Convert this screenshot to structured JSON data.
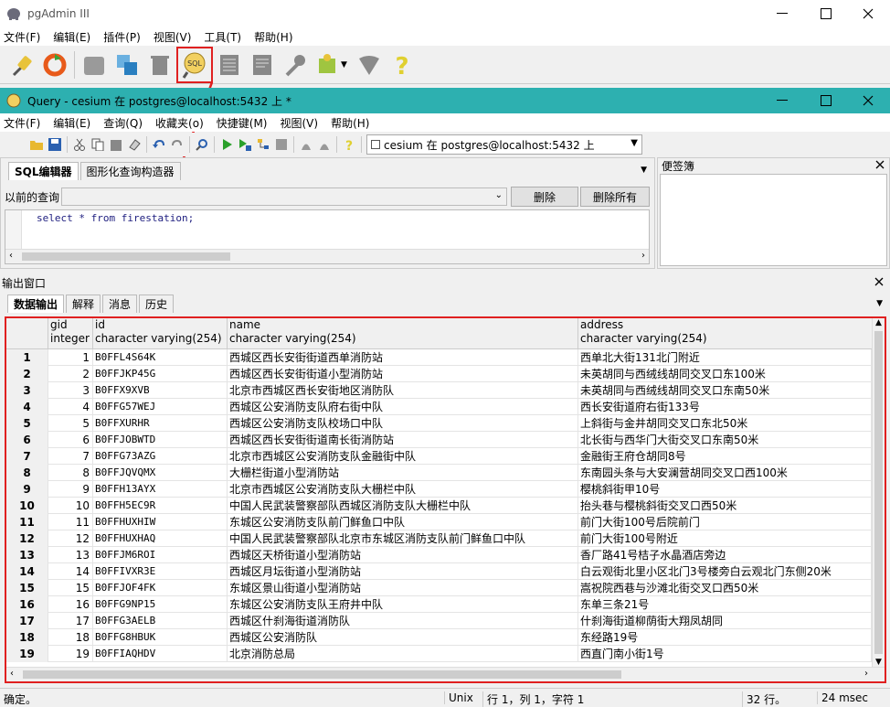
{
  "main_window": {
    "title": "pgAdmin III",
    "menu": [
      "文件(F)",
      "编辑(E)",
      "插件(P)",
      "视图(V)",
      "工具(T)",
      "帮助(H)"
    ]
  },
  "query_window": {
    "title": "Query - cesium 在  postgres@localhost:5432 上 *",
    "menu": [
      "文件(F)",
      "编辑(E)",
      "查询(Q)",
      "收藏夹(o)",
      "快捷键(M)",
      "视图(V)",
      "帮助(H)"
    ],
    "connection": "cesium 在  postgres@localhost:5432 上"
  },
  "editor": {
    "tabs": [
      "SQL编辑器",
      "图形化查询构造器"
    ],
    "prev_query_label": "以前的查询",
    "delete_label": "删除",
    "delete_all_label": "删除所有",
    "sql": "select * from firestation;"
  },
  "notepad": {
    "title": "便签簿"
  },
  "output": {
    "title": "输出窗口",
    "tabs": [
      "数据输出",
      "解释",
      "消息",
      "历史"
    ],
    "columns": [
      {
        "name": "gid",
        "type": "integer"
      },
      {
        "name": "id",
        "type": "character varying(254)"
      },
      {
        "name": "name",
        "type": "character varying(254)"
      },
      {
        "name": "address",
        "type": "character varying(254)"
      }
    ],
    "rows": [
      {
        "n": "1",
        "gid": "1",
        "id": "B0FFL4S64K",
        "name": "西城区西长安街街道西单消防站",
        "address": "西单北大街131北门附近"
      },
      {
        "n": "2",
        "gid": "2",
        "id": "B0FFJKP45G",
        "name": "西城区西长安街街道小型消防站",
        "address": "未英胡同与西绒线胡同交叉口东100米"
      },
      {
        "n": "3",
        "gid": "3",
        "id": "B0FFX9XVB",
        "name": "北京市西城区西长安街地区消防队",
        "address": "未英胡同与西绒线胡同交叉口东南50米"
      },
      {
        "n": "4",
        "gid": "4",
        "id": "B0FFG57WEJ",
        "name": "西城区公安消防支队府右街中队",
        "address": "西长安街道府右街133号"
      },
      {
        "n": "5",
        "gid": "5",
        "id": "B0FFXURHR",
        "name": "西城区公安消防支队校场口中队",
        "address": "上斜街与金井胡同交叉口东北50米"
      },
      {
        "n": "6",
        "gid": "6",
        "id": "B0FFJOBWTD",
        "name": "西城区西长安街街道南长街消防站",
        "address": "北长街与西华门大街交叉口东南50米"
      },
      {
        "n": "7",
        "gid": "7",
        "id": "B0FFG73AZG",
        "name": "北京市西城区公安消防支队金融街中队",
        "address": "金融街王府仓胡同8号"
      },
      {
        "n": "8",
        "gid": "8",
        "id": "B0FFJQVQMX",
        "name": "大栅栏街道小型消防站",
        "address": "东南园头条与大安澜营胡同交叉口西100米"
      },
      {
        "n": "9",
        "gid": "9",
        "id": "B0FFH13AYX",
        "name": "北京市西城区公安消防支队大栅栏中队",
        "address": "樱桃斜街甲10号"
      },
      {
        "n": "10",
        "gid": "10",
        "id": "B0FFH5EC9R",
        "name": "中国人民武装警察部队西城区消防支队大栅栏中队",
        "address": "抬头巷与樱桃斜街交叉口西50米"
      },
      {
        "n": "11",
        "gid": "11",
        "id": "B0FFHUXHIW",
        "name": "东城区公安消防支队前门鲜鱼口中队",
        "address": "前门大街100号后院前门"
      },
      {
        "n": "12",
        "gid": "12",
        "id": "B0FFHUXHAQ",
        "name": "中国人民武装警察部队北京市东城区消防支队前门鲜鱼口中队",
        "address": "前门大街100号附近"
      },
      {
        "n": "13",
        "gid": "13",
        "id": "B0FFJM6ROI",
        "name": "西城区天桥街道小型消防站",
        "address": "香厂路41号桔子水晶酒店旁边"
      },
      {
        "n": "14",
        "gid": "14",
        "id": "B0FFIVXR3E",
        "name": "西城区月坛街道小型消防站",
        "address": "白云观街北里小区北门3号楼旁白云观北门东侧20米"
      },
      {
        "n": "15",
        "gid": "15",
        "id": "B0FFJOF4FK",
        "name": "东城区景山街道小型消防站",
        "address": "嵩祝院西巷与沙滩北街交叉口西50米"
      },
      {
        "n": "16",
        "gid": "16",
        "id": "B0FFG9NP15",
        "name": "东城区公安消防支队王府井中队",
        "address": "东单三条21号"
      },
      {
        "n": "17",
        "gid": "17",
        "id": "B0FFG3AELB",
        "name": "西城区什刹海街道消防队",
        "address": "什刹海街道柳荫街大翔凤胡同"
      },
      {
        "n": "18",
        "gid": "18",
        "id": "B0FFG8HBUK",
        "name": "西城区公安消防队",
        "address": "东经路19号"
      },
      {
        "n": "19",
        "gid": "19",
        "id": "B0FFIAQHDV",
        "name": "北京消防总局",
        "address": "西直门南小街1号"
      }
    ]
  },
  "status": {
    "message": "确定。",
    "eol": "Unix",
    "position": "行 1，列 1，字符 1",
    "rows": "32 行。",
    "time": "24 msec"
  }
}
